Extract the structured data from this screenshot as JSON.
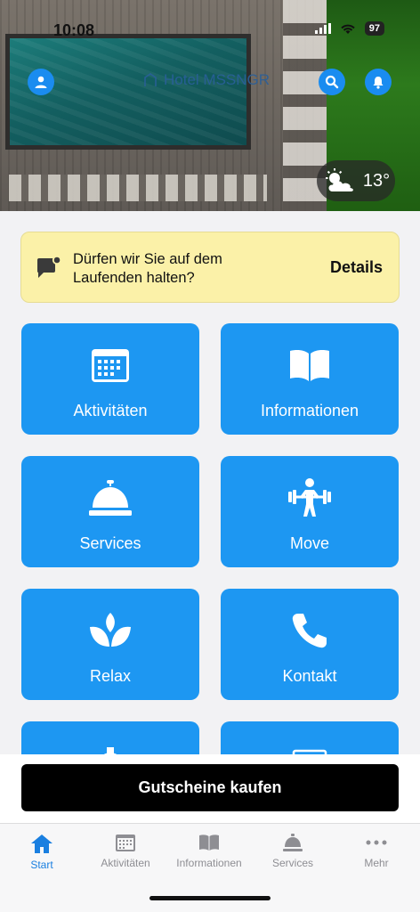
{
  "status": {
    "time": "10:08",
    "battery": "97"
  },
  "header": {
    "hotel_name": "Hotel MSSNGR"
  },
  "weather": {
    "temperature": "13°",
    "icon": "partly-cloudy-icon"
  },
  "notice": {
    "text": "Dürfen wir Sie auf dem Laufenden halten?",
    "details_label": "Details"
  },
  "tiles": [
    {
      "label": "Aktivitäten",
      "icon": "calendar-icon"
    },
    {
      "label": "Informationen",
      "icon": "book-icon"
    },
    {
      "label": "Services",
      "icon": "service-bell-icon"
    },
    {
      "label": "Move",
      "icon": "weightlifter-icon"
    },
    {
      "label": "Relax",
      "icon": "lotus-icon"
    },
    {
      "label": "Kontakt",
      "icon": "phone-icon"
    }
  ],
  "cta": {
    "label": "Gutscheine kaufen"
  },
  "tabbar": [
    {
      "label": "Start",
      "icon": "home-icon",
      "active": true
    },
    {
      "label": "Aktivitäten",
      "icon": "calendar-icon",
      "active": false
    },
    {
      "label": "Informationen",
      "icon": "book-icon",
      "active": false
    },
    {
      "label": "Services",
      "icon": "service-bell-icon",
      "active": false
    },
    {
      "label": "Mehr",
      "icon": "more-dots-icon",
      "active": false
    }
  ],
  "colors": {
    "accent": "#1d97f2",
    "notice_bg": "#fbf1a8",
    "cta_bg": "#000000",
    "tab_active": "#1a7fe0"
  }
}
